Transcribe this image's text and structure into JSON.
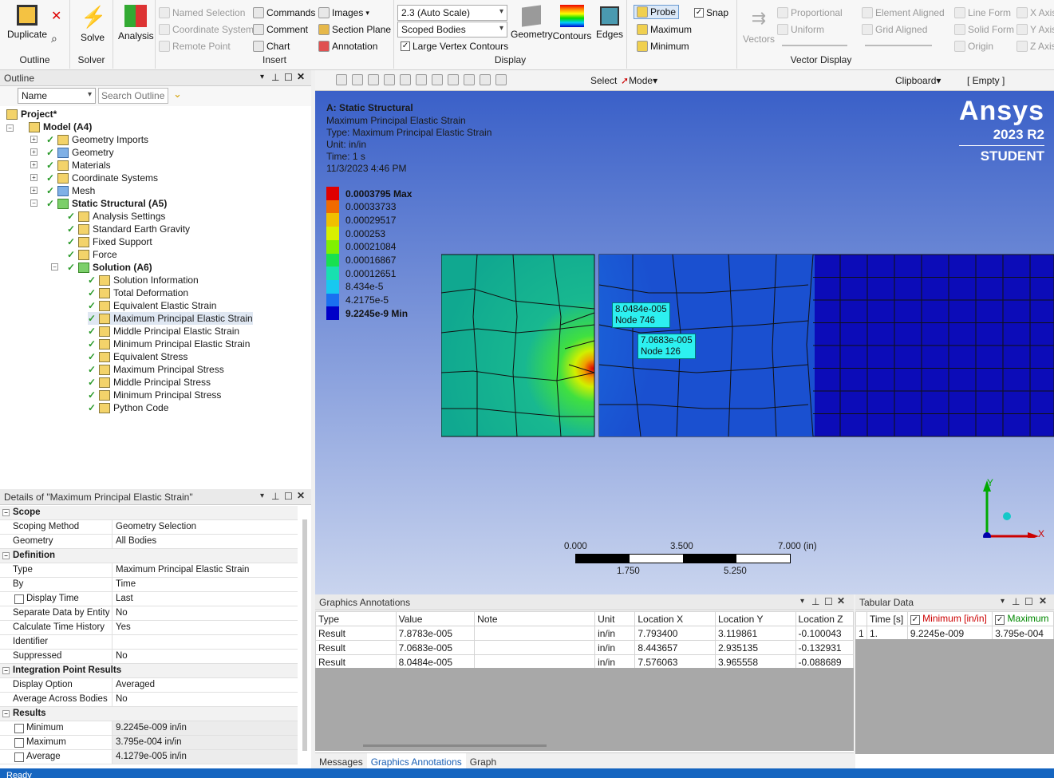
{
  "ribbon": {
    "outline_group": {
      "label": "Outline",
      "duplicate": "Duplicate"
    },
    "solve_group": {
      "label": "Solver",
      "solve": "Solve"
    },
    "analysis": "Analysis",
    "insert_group": {
      "label": "Insert",
      "named_selection": "Named Selection",
      "coordinate_system": "Coordinate System",
      "remote_point": "Remote Point",
      "commands": "Commands",
      "comment": "Comment",
      "chart": "Chart",
      "images": "Images",
      "section_plane": "Section Plane",
      "annotation": "Annotation"
    },
    "display_group": {
      "label": "Display",
      "scale": "2.3 (Auto Scale)",
      "scope": "Scoped Bodies",
      "large_vertex": "Large Vertex Contours",
      "geometry": "Geometry",
      "contours": "Contours",
      "edges": "Edges"
    },
    "probe": "Probe",
    "maximum": "Maximum",
    "minimum": "Minimum",
    "snap": "Snap",
    "vector_group": {
      "label": "Vector Display",
      "vectors": "Vectors",
      "proportional": "Proportional",
      "uniform": "Uniform",
      "element_aligned": "Element Aligned",
      "grid_aligned": "Grid Aligned",
      "line_form": "Line Form",
      "solid_form": "Solid Form",
      "origin": "Origin",
      "x_axis": "X Axis",
      "y_axis": "Y Axis",
      "z_axis": "Z Axis"
    }
  },
  "outline": {
    "title": "Outline",
    "filter": "Name",
    "search_placeholder": "Search Outline",
    "items": [
      {
        "label": "Project*",
        "level": 0
      },
      {
        "label": "Model (A4)",
        "level": 1
      },
      {
        "label": "Geometry Imports",
        "level": 2
      },
      {
        "label": "Geometry",
        "level": 2
      },
      {
        "label": "Materials",
        "level": 2
      },
      {
        "label": "Coordinate Systems",
        "level": 2
      },
      {
        "label": "Mesh",
        "level": 2
      },
      {
        "label": "Static Structural (A5)",
        "level": 2
      },
      {
        "label": "Analysis Settings",
        "level": 3
      },
      {
        "label": "Standard Earth Gravity",
        "level": 3
      },
      {
        "label": "Fixed Support",
        "level": 3
      },
      {
        "label": "Force",
        "level": 3
      },
      {
        "label": "Solution (A6)",
        "level": 3
      },
      {
        "label": "Solution Information",
        "level": 4
      },
      {
        "label": "Total Deformation",
        "level": 4
      },
      {
        "label": "Equivalent Elastic Strain",
        "level": 4
      },
      {
        "label": "Maximum Principal Elastic Strain",
        "level": 4
      },
      {
        "label": "Middle Principal Elastic Strain",
        "level": 4
      },
      {
        "label": "Minimum Principal Elastic Strain",
        "level": 4
      },
      {
        "label": "Equivalent Stress",
        "level": 4
      },
      {
        "label": "Maximum Principal Stress",
        "level": 4
      },
      {
        "label": "Middle Principal Stress",
        "level": 4
      },
      {
        "label": "Minimum Principal Stress",
        "level": 4
      },
      {
        "label": "Python Code",
        "level": 4
      }
    ]
  },
  "details": {
    "title": "Details of \"Maximum Principal Elastic Strain\"",
    "rows": [
      {
        "k": "Scope",
        "v": "",
        "sec": true
      },
      {
        "k": "Scoping Method",
        "v": "Geometry Selection"
      },
      {
        "k": "Geometry",
        "v": "All Bodies"
      },
      {
        "k": "Definition",
        "v": "",
        "sec": true
      },
      {
        "k": "Type",
        "v": "Maximum Principal Elastic Strain"
      },
      {
        "k": "By",
        "v": "Time"
      },
      {
        "k": "Display Time",
        "v": "Last"
      },
      {
        "k": "Separate Data by Entity",
        "v": "No"
      },
      {
        "k": "Calculate Time History",
        "v": "Yes"
      },
      {
        "k": "Identifier",
        "v": ""
      },
      {
        "k": "Suppressed",
        "v": "No"
      },
      {
        "k": "Integration Point Results",
        "v": "",
        "sec": true
      },
      {
        "k": "Display Option",
        "v": "Averaged"
      },
      {
        "k": "Average Across Bodies",
        "v": "No"
      },
      {
        "k": "Results",
        "v": "",
        "sec": true
      },
      {
        "k": "Minimum",
        "v": "9.2245e-009 in/in"
      },
      {
        "k": "Maximum",
        "v": "3.795e-004 in/in"
      },
      {
        "k": "Average",
        "v": "4.1279e-005 in/in"
      }
    ]
  },
  "toolbar": {
    "select": "Select",
    "mode": "Mode",
    "clipboard": "Clipboard",
    "empty": "[ Empty ]"
  },
  "viewport": {
    "title": "A: Static Structural",
    "lines": [
      "Maximum Principal Elastic Strain",
      "Type: Maximum Principal Elastic Strain",
      "Unit: in/in",
      "Time: 1 s",
      "11/3/2023 4:46 PM"
    ],
    "brand": "Ansys",
    "version": "2023 R2",
    "edition": "STUDENT",
    "legend": [
      {
        "label": "0.0003795 Max",
        "color": "#e00000"
      },
      {
        "label": "0.00033733",
        "color": "#f06a00"
      },
      {
        "label": "0.00029517",
        "color": "#f0c000"
      },
      {
        "label": "0.000253",
        "color": "#d8f000"
      },
      {
        "label": "0.00021084",
        "color": "#80f000"
      },
      {
        "label": "0.00016867",
        "color": "#18e050"
      },
      {
        "label": "0.00012651",
        "color": "#18e0b0"
      },
      {
        "label": "8.434e-5",
        "color": "#18c8f0"
      },
      {
        "label": "4.2175e-5",
        "color": "#1a70f0"
      },
      {
        "label": "9.2245e-9 Min",
        "color": "#0000c8"
      }
    ],
    "probes": [
      {
        "value": "8.0484e-005",
        "node": "Node 746"
      },
      {
        "value": "7.0683e-005",
        "node": "Node 126"
      }
    ],
    "scale": {
      "t0": "0.000",
      "t1": "3.500",
      "t2": "7.000 (in)",
      "b1": "1.750",
      "b2": "5.250"
    },
    "axes": {
      "x": "X",
      "y": "Y"
    }
  },
  "graphics_annotations": {
    "title": "Graphics Annotations",
    "headers": [
      "Type",
      "Value",
      "Note",
      "Unit",
      "Location X",
      "Location Y",
      "Location Z"
    ],
    "rows": [
      [
        "Result",
        "7.8783e-005",
        "",
        "in/in",
        "7.793400",
        "3.119861",
        "-0.100043"
      ],
      [
        "Result",
        "7.0683e-005",
        "",
        "in/in",
        "8.443657",
        "2.935135",
        "-0.132931"
      ],
      [
        "Result",
        "8.0484e-005",
        "",
        "in/in",
        "7.576063",
        "3.965558",
        "-0.088689"
      ]
    ]
  },
  "tabular": {
    "title": "Tabular Data",
    "headers": [
      "Time [s]",
      "Minimum [in/in]",
      "Maximum"
    ],
    "row": [
      "1",
      "1.",
      "9.2245e-009",
      "3.795e-004"
    ]
  },
  "bottom_tabs": [
    "Messages",
    "Graphics Annotations",
    "Graph"
  ],
  "status": "Ready"
}
